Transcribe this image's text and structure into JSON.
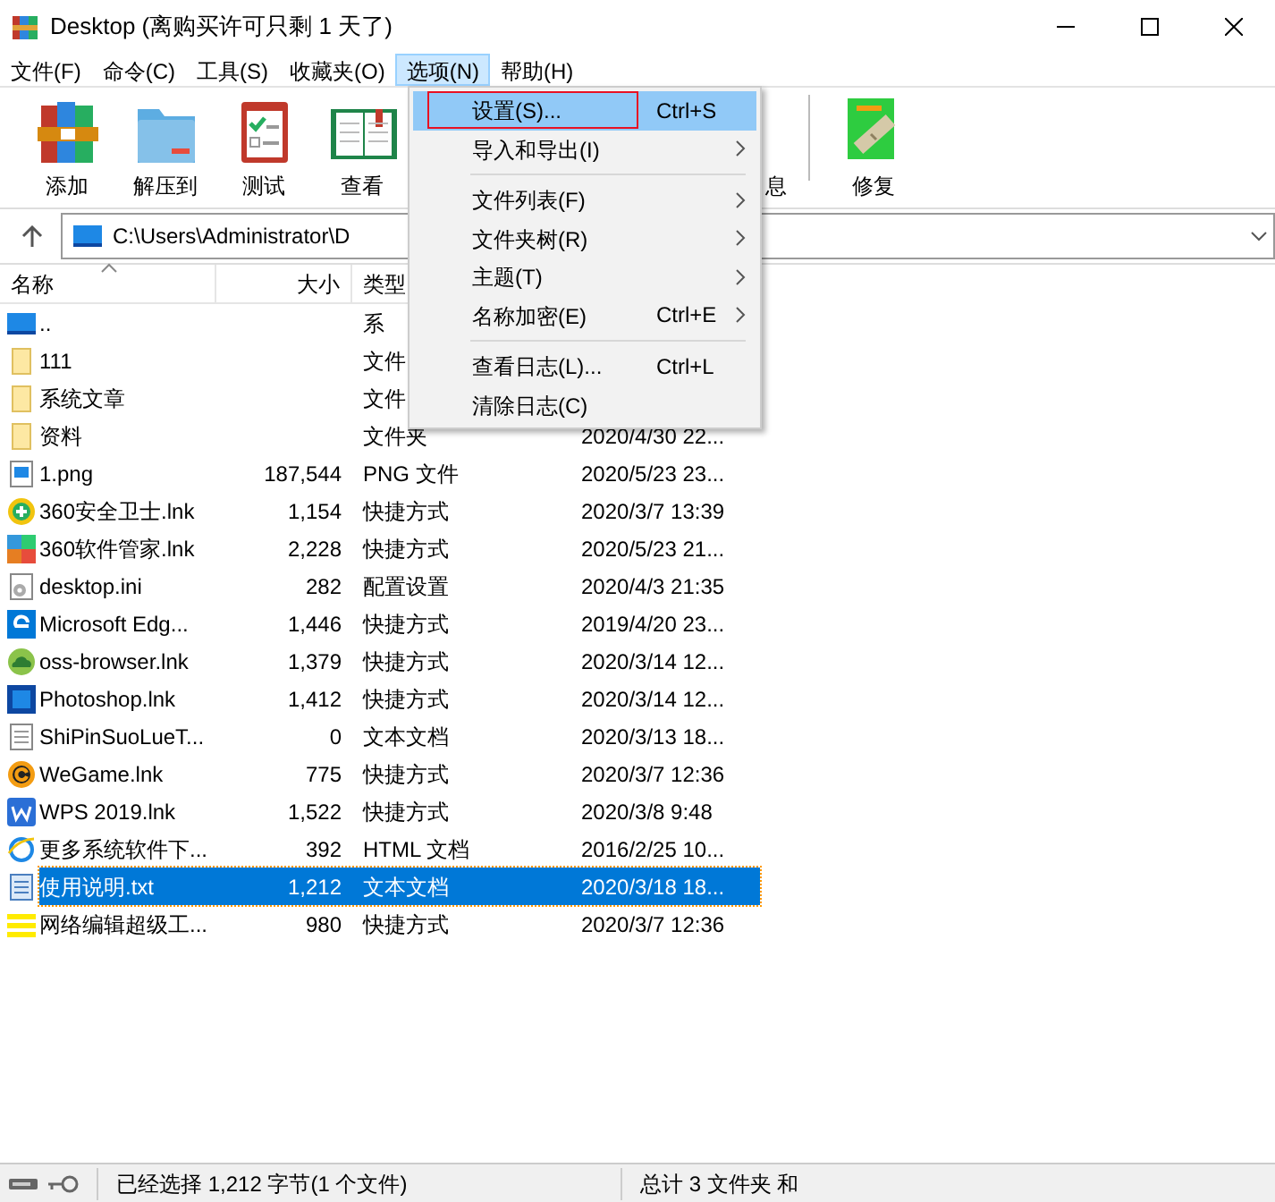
{
  "window": {
    "title": "Desktop (离购买许可只剩 1 天了)"
  },
  "menu_bar": [
    {
      "label": "文件(F)",
      "selected": false
    },
    {
      "label": "命令(C)",
      "selected": false
    },
    {
      "label": "工具(S)",
      "selected": false
    },
    {
      "label": "收藏夹(O)",
      "selected": false
    },
    {
      "label": "选项(N)",
      "selected": true
    },
    {
      "label": "帮助(H)",
      "selected": false
    }
  ],
  "toolbar": [
    {
      "label": "添加"
    },
    {
      "label": "解压到"
    },
    {
      "label": "测试"
    },
    {
      "label": "查看"
    },
    {
      "label": "息"
    },
    {
      "label": "修复"
    }
  ],
  "address_bar": {
    "path": "C:\\Users\\Administrator\\D"
  },
  "columns": [
    "名称",
    "大小",
    "类型"
  ],
  "rows": [
    {
      "name": "..",
      "type": "系",
      "selected": false
    },
    {
      "name": "111",
      "type": "文件",
      "selected": false
    },
    {
      "name": "系统文章",
      "type": "文件",
      "selected": false
    },
    {
      "name": "资料",
      "type": "文件夹",
      "modified": "2020/4/30 22...",
      "selected": false
    },
    {
      "name": "1.png",
      "size": "187,544",
      "type": "PNG 文件",
      "modified": "2020/5/23 23...",
      "selected": false
    },
    {
      "name": "360安全卫士.lnk",
      "size": "1,154",
      "type": "快捷方式",
      "modified": "2020/3/7 13:39",
      "selected": false
    },
    {
      "name": "360软件管家.lnk",
      "size": "2,228",
      "type": "快捷方式",
      "modified": "2020/5/23 21...",
      "selected": false
    },
    {
      "name": "desktop.ini",
      "size": "282",
      "type": "配置设置",
      "modified": "2020/4/3 21:35",
      "selected": false
    },
    {
      "name": "Microsoft Edg...",
      "size": "1,446",
      "type": "快捷方式",
      "modified": "2019/4/20 23...",
      "selected": false
    },
    {
      "name": "oss-browser.lnk",
      "size": "1,379",
      "type": "快捷方式",
      "modified": "2020/3/14 12...",
      "selected": false
    },
    {
      "name": "Photoshop.lnk",
      "size": "1,412",
      "type": "快捷方式",
      "modified": "2020/3/14 12...",
      "selected": false
    },
    {
      "name": "ShiPinSuoLueT...",
      "size": "0",
      "type": "文本文档",
      "modified": "2020/3/13 18...",
      "selected": false
    },
    {
      "name": "WeGame.lnk",
      "size": "775",
      "type": "快捷方式",
      "modified": "2020/3/7 12:36",
      "selected": false
    },
    {
      "name": "WPS 2019.lnk",
      "size": "1,522",
      "type": "快捷方式",
      "modified": "2020/3/8 9:48",
      "selected": false
    },
    {
      "name": "更多系统软件下...",
      "size": "392",
      "type": "HTML 文档",
      "modified": "2016/2/25 10...",
      "selected": false
    },
    {
      "name": "使用说明.txt",
      "size": "1,212",
      "type": "文本文档",
      "modified": "2020/3/18 18...",
      "selected": true
    },
    {
      "name": "网络编辑超级工...",
      "size": "980",
      "type": "快捷方式",
      "modified": "2020/3/7 12:36",
      "selected": false
    }
  ],
  "dropdown_menu": [
    {
      "kind": "item",
      "label": "设置(S)...",
      "shortcut": "Ctrl+S",
      "submenu": false,
      "selected": true
    },
    {
      "kind": "item",
      "label": "导入和导出(I)",
      "submenu": true,
      "selected": false
    },
    {
      "kind": "separator"
    },
    {
      "kind": "item",
      "label": "文件列表(F)",
      "submenu": true,
      "selected": false
    },
    {
      "kind": "item",
      "label": "文件夹树(R)",
      "submenu": true,
      "selected": false
    },
    {
      "kind": "item",
      "label": "主题(T)",
      "submenu": true,
      "selected": false
    },
    {
      "kind": "item",
      "label": "名称加密(E)",
      "shortcut": "Ctrl+E",
      "submenu": true,
      "selected": false
    },
    {
      "kind": "separator"
    },
    {
      "kind": "item",
      "label": "查看日志(L)...",
      "shortcut": "Ctrl+L",
      "submenu": false,
      "selected": false
    },
    {
      "kind": "item",
      "label": "清除日志(C)",
      "submenu": false,
      "selected": false
    }
  ],
  "status_bar": {
    "left": "已经选择 1,212 字节(1 个文件)",
    "right": "总计 3 文件夹 和"
  }
}
